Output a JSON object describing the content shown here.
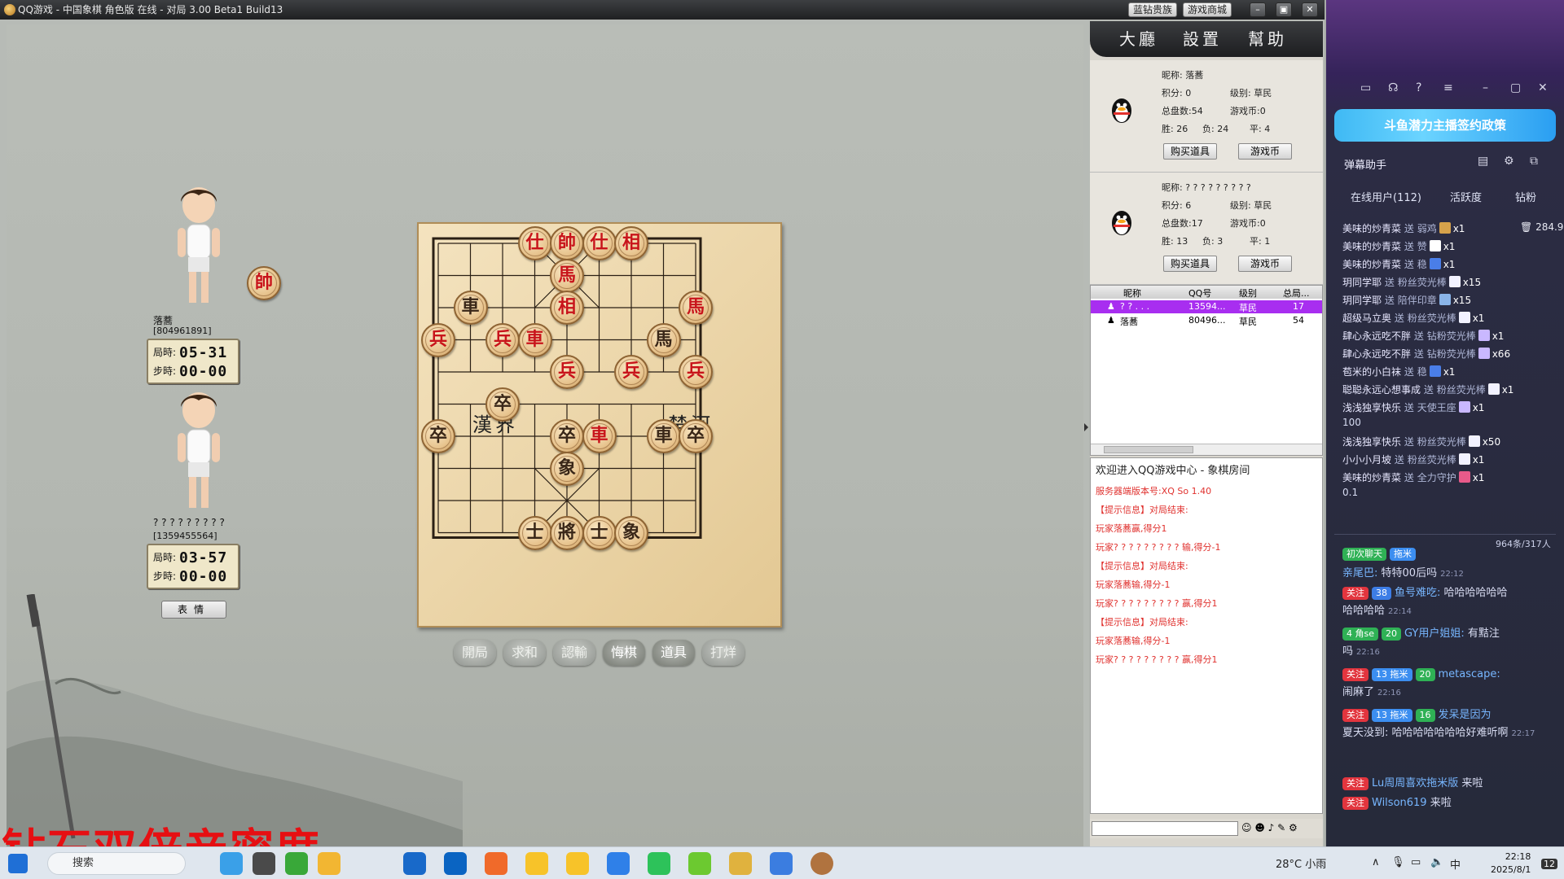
{
  "window": {
    "title": "QQ游戏 - 中国象棋  角色版  在线 - 对局 3.00 Beta1 Build13",
    "btn_vip": "蓝钻贵族",
    "btn_mall": "游戏商城"
  },
  "menu": {
    "lobby": "大廳",
    "settings": "設置",
    "help": "幫助"
  },
  "players": {
    "top": {
      "name": "落蕎",
      "qq": "[804961891]",
      "game_time_label": "局時:",
      "game_time": "05-31",
      "step_time_label": "步時:",
      "step_time": "00-00",
      "side_piece": "帥"
    },
    "bottom": {
      "name": "? ? ? ? ? ? ? ? ?",
      "qq": "[1359455564]",
      "game_time_label": "局時:",
      "game_time": "03-57",
      "step_time_label": "步時:",
      "step_time": "00-00"
    },
    "emote_label": "表情"
  },
  "board": {
    "river_left": "漢界",
    "river_right": "楚河",
    "pieces": [
      {
        "ch": "仕",
        "color": "red",
        "col": 3,
        "row": 0
      },
      {
        "ch": "帥",
        "color": "red",
        "col": 4,
        "row": 0
      },
      {
        "ch": "仕",
        "color": "red",
        "col": 5,
        "row": 0
      },
      {
        "ch": "相",
        "color": "red",
        "col": 6,
        "row": 0
      },
      {
        "ch": "馬",
        "color": "red",
        "col": 4,
        "row": 1
      },
      {
        "ch": "車",
        "color": "black",
        "col": 1,
        "row": 2
      },
      {
        "ch": "相",
        "color": "red",
        "col": 4,
        "row": 2
      },
      {
        "ch": "馬",
        "color": "red",
        "col": 8,
        "row": 2
      },
      {
        "ch": "兵",
        "color": "red",
        "col": 0,
        "row": 3
      },
      {
        "ch": "兵",
        "color": "red",
        "col": 2,
        "row": 3
      },
      {
        "ch": "車",
        "color": "red",
        "col": 3,
        "row": 3
      },
      {
        "ch": "馬",
        "color": "black",
        "col": 7,
        "row": 3
      },
      {
        "ch": "兵",
        "color": "red",
        "col": 4,
        "row": 4
      },
      {
        "ch": "兵",
        "color": "red",
        "col": 6,
        "row": 4
      },
      {
        "ch": "兵",
        "color": "red",
        "col": 8,
        "row": 4
      },
      {
        "ch": "卒",
        "color": "black",
        "col": 2,
        "row": 5
      },
      {
        "ch": "卒",
        "color": "black",
        "col": 0,
        "row": 6
      },
      {
        "ch": "卒",
        "color": "black",
        "col": 4,
        "row": 6
      },
      {
        "ch": "車",
        "color": "red",
        "col": 5,
        "row": 6
      },
      {
        "ch": "車",
        "color": "black",
        "col": 7,
        "row": 6
      },
      {
        "ch": "卒",
        "color": "black",
        "col": 8,
        "row": 6
      },
      {
        "ch": "象",
        "color": "black",
        "col": 4,
        "row": 7
      },
      {
        "ch": "士",
        "color": "black",
        "col": 3,
        "row": 9
      },
      {
        "ch": "將",
        "color": "black",
        "col": 4,
        "row": 9
      },
      {
        "ch": "士",
        "color": "black",
        "col": 5,
        "row": 9
      },
      {
        "ch": "象",
        "color": "black",
        "col": 6,
        "row": 9
      }
    ]
  },
  "actions": [
    "開局",
    "求和",
    "認輸",
    "悔棋",
    "道具",
    "打烊"
  ],
  "info_cards": [
    {
      "nickname_label": "昵称:",
      "nickname": "落蕎",
      "score_label": "积分:",
      "score": "0",
      "level_label": "级别:",
      "level": "草民",
      "total_label": "总盘数:",
      "total": "54",
      "coins_label": "游戏币:",
      "coins": "0",
      "win_label": "胜:",
      "win": "26",
      "lose_label": "负:",
      "lose": "24",
      "draw_label": "平:",
      "draw": "4",
      "buy_btn": "购买道具",
      "coin_btn": "游戏币"
    },
    {
      "nickname_label": "昵称:",
      "nickname": "? ? ? ? ? ? ? ? ?",
      "score_label": "积分:",
      "score": "6",
      "level_label": "级别:",
      "level": "草民",
      "total_label": "总盘数:",
      "total": "17",
      "coins_label": "游戏币:",
      "coins": "0",
      "win_label": "胜:",
      "win": "13",
      "lose_label": "负:",
      "lose": "3",
      "draw_label": "平:",
      "draw": "1",
      "buy_btn": "购买道具",
      "coin_btn": "游戏币"
    }
  ],
  "player_table": {
    "headers": [
      "昵称",
      "QQ号",
      "级别",
      "总局..."
    ],
    "rows": [
      {
        "name": "? ? . . .",
        "qq": "13594...",
        "level": "草民",
        "total": "17",
        "selected": true
      },
      {
        "name": "落蕎",
        "qq": "80496...",
        "level": "草民",
        "total": "54",
        "selected": false
      }
    ]
  },
  "chat_log": {
    "welcome": "欢迎进入QQ游戏中心 - 象棋房间",
    "lines": [
      "服务器端版本号:XQ So 1.40",
      "【提示信息】对局结束:",
      "玩家落蕎赢,得分1",
      "玩家? ? ? ? ? ? ? ? ? 输,得分-1",
      "【提示信息】对局结束:",
      "玩家落蕎输,得分-1",
      "玩家? ? ? ? ? ? ? ? ? 赢,得分1",
      "【提示信息】对局结束:",
      "玩家落蕎输,得分-1",
      "玩家? ? ? ? ? ? ? ? ? 赢,得分1"
    ]
  },
  "overlay_text": "钻石双倍亲密度",
  "douyu": {
    "banner": "斗鱼潜力主播签约政策",
    "title": "弹幕助手",
    "tabs": [
      "在线用户(112)",
      "活跃度",
      "钻粉"
    ],
    "gift_total": "284.9",
    "gifts": [
      {
        "user": "美味的炒青菜",
        "act": "送",
        "item": "弱鸡",
        "count": "x1",
        "chip": "#d6a24b"
      },
      {
        "user": "美味的炒青菜",
        "act": "送",
        "item": "赞",
        "count": "x1",
        "chip": "#ffffff"
      },
      {
        "user": "美味的炒青菜",
        "act": "送",
        "item": "稳",
        "count": "x1",
        "chip": "#4a7ee8"
      },
      {
        "user": "玥同学耶",
        "act": "送",
        "item": "粉丝荧光棒",
        "count": "x15",
        "chip": "#f2f2ff"
      },
      {
        "user": "玥同学耶",
        "act": "送",
        "item": "陪伴印章",
        "count": "x15",
        "chip": "#8ab4e8"
      },
      {
        "user": "超级马立奥",
        "act": "送",
        "item": "粉丝荧光棒",
        "count": "x1",
        "chip": "#f2f2ff"
      },
      {
        "user": "肆心永远吃不胖",
        "act": "送",
        "item": "钻粉荧光棒",
        "count": "x1",
        "chip": "#c9b8ff"
      },
      {
        "user": "肆心永远吃不胖",
        "act": "送",
        "item": "钻粉荧光棒",
        "count": "x66",
        "chip": "#c9b8ff"
      },
      {
        "user": "苞米的小白袜",
        "act": "送",
        "item": "稳",
        "count": "x1",
        "chip": "#4a7ee8"
      },
      {
        "user": "聪聪永远心想事成",
        "act": "送",
        "item": "粉丝荧光棒",
        "count": "x1",
        "chip": "#f2f2ff"
      },
      {
        "user": "浅浅独享快乐",
        "act": "送",
        "item": "天使王座",
        "count": "x1",
        "chip": "#c9b8ff",
        "extra": "100"
      },
      {
        "user": "浅浅独享快乐",
        "act": "送",
        "item": "粉丝荧光棒",
        "count": "x50",
        "chip": "#f2f2ff"
      },
      {
        "user": "小小小月坡",
        "act": "送",
        "item": "粉丝荧光棒",
        "count": "x1",
        "chip": "#f2f2ff"
      },
      {
        "user": "美味的炒青菜",
        "act": "送",
        "item": "全力守护",
        "count": "x1",
        "chip": "#e85a8a",
        "extra": "0.1"
      }
    ],
    "msg_count": "964条/317人",
    "messages": [
      {
        "tags": [
          [
            "初次聊天",
            "green"
          ],
          [
            "拖米",
            "blue"
          ]
        ],
        "name": "",
        "text": ""
      },
      {
        "tags": [],
        "name": "亲尾巴:",
        "text": "特特00后吗",
        "time": "22:12"
      },
      {
        "tags": [
          [
            "关注",
            "red"
          ],
          [
            "38",
            "teal"
          ]
        ],
        "name": "鱼号难吃:",
        "text": "哈哈哈哈哈哈",
        "cont": "哈哈哈哈",
        "time": "22:14"
      },
      {
        "tags": [
          [
            "4 角se",
            "green"
          ],
          [
            "20",
            "green"
          ]
        ],
        "name": "GY用户姐姐:",
        "text": "有黠注",
        "cont": "吗",
        "time": "22:16"
      },
      {
        "tags": [
          [
            "关注",
            "red"
          ],
          [
            "13 拖米",
            "blue"
          ],
          [
            "20",
            "green"
          ]
        ],
        "name": "metascape:",
        "text": "",
        "cont": "闹麻了",
        "time": "22:16"
      },
      {
        "tags": [
          [
            "关注",
            "red"
          ],
          [
            "13 拖米",
            "blue"
          ],
          [
            "16",
            "green"
          ]
        ],
        "name": "发呆是因为",
        "text": "",
        "cont": "夏天没到: 哈哈哈哈哈哈哈好难听啊",
        "time": "22:17"
      },
      {
        "tags": [
          [
            "关注",
            "red"
          ]
        ],
        "name": "Lu周周喜欢拖米版",
        "text": "来啦"
      },
      {
        "tags": [
          [
            "关注",
            "red"
          ]
        ],
        "name": "Wilson619",
        "text": "来啦"
      }
    ]
  },
  "taskbar": {
    "search": "搜索",
    "weather": "28°C  小雨",
    "ime": "中",
    "time": "22:18",
    "date": "2025/8/1",
    "notif": "12"
  }
}
